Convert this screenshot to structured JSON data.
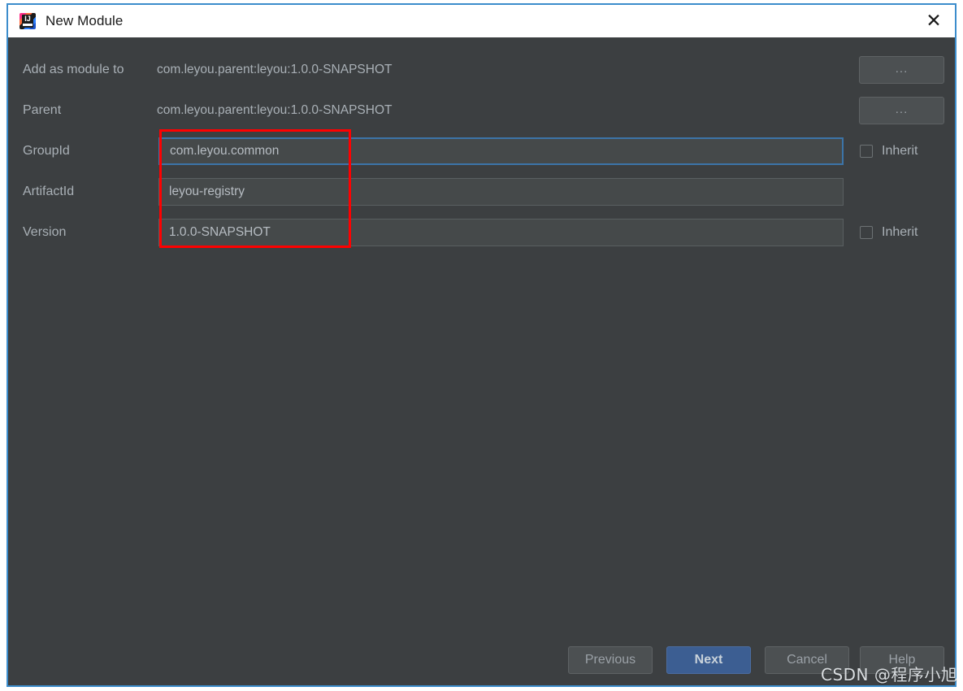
{
  "window": {
    "title": "New Module",
    "app_icon": "intellij-idea-icon",
    "close_icon": "close-icon",
    "accent_color": "#3c8dcc",
    "panel_color": "#3c3f41",
    "field_color": "#45494a",
    "focus_border_color": "#3c74a8",
    "annotation_color": "#ff0000"
  },
  "form": {
    "rows": [
      {
        "label": "Add as module to",
        "type": "static",
        "value": "com.leyou.parent:leyou:1.0.0-SNAPSHOT",
        "button": "...",
        "has_button": true,
        "has_inherit": false
      },
      {
        "label": "Parent",
        "type": "static",
        "value": "com.leyou.parent:leyou:1.0.0-SNAPSHOT",
        "button": "...",
        "has_button": true,
        "has_inherit": false
      },
      {
        "label": "GroupId",
        "type": "input",
        "value": "com.leyou.common",
        "placeholder": "",
        "focused": true,
        "has_button": false,
        "has_inherit": true,
        "inherit_label": "Inherit",
        "inherit_checked": false
      },
      {
        "label": "ArtifactId",
        "type": "input",
        "value": "leyou-registry",
        "placeholder": "",
        "focused": false,
        "has_button": false,
        "has_inherit": false
      },
      {
        "label": "Version",
        "type": "input",
        "value": "1.0.0-SNAPSHOT",
        "placeholder": "",
        "focused": false,
        "has_button": false,
        "has_inherit": true,
        "inherit_label": "Inherit",
        "inherit_checked": false
      }
    ]
  },
  "footer": {
    "previous_label": "Previous",
    "next_label": "Next",
    "cancel_label": "Cancel",
    "help_label": "Help"
  },
  "watermark": {
    "text": "CSDN @程序小旭"
  }
}
